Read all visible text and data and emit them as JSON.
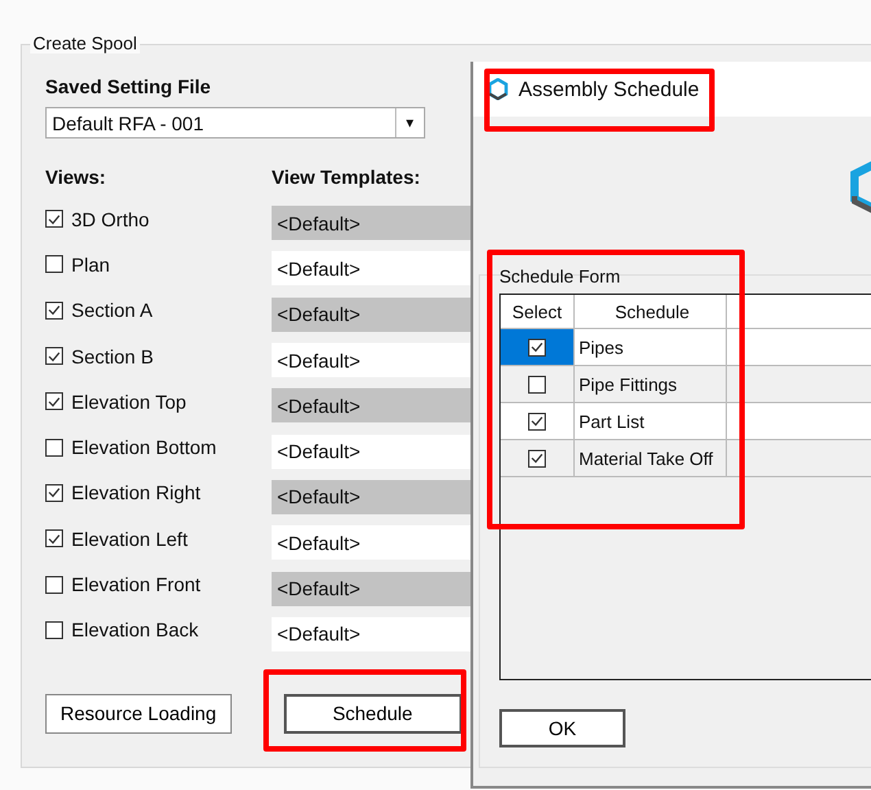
{
  "group_title": "Create Spool",
  "saved_setting": {
    "label": "Saved Setting File",
    "value": "Default RFA - 001",
    "arrow": "▾"
  },
  "views_header": "Views:",
  "templates_header": "View Templates:",
  "views": [
    {
      "name": "3D Ortho",
      "checked": true,
      "template": "<Default>"
    },
    {
      "name": "Plan",
      "checked": false,
      "template": "<Default>"
    },
    {
      "name": "Section A",
      "checked": true,
      "template": "<Default>"
    },
    {
      "name": "Section B",
      "checked": true,
      "template": "<Default>"
    },
    {
      "name": "Elevation Top",
      "checked": true,
      "template": "<Default>"
    },
    {
      "name": "Elevation Bottom",
      "checked": false,
      "template": "<Default>"
    },
    {
      "name": "Elevation Right",
      "checked": true,
      "template": "<Default>"
    },
    {
      "name": "Elevation Left",
      "checked": true,
      "template": "<Default>"
    },
    {
      "name": "Elevation Front",
      "checked": false,
      "template": "<Default>"
    },
    {
      "name": "Elevation Back",
      "checked": false,
      "template": "<Default>"
    }
  ],
  "buttons": [
    {
      "label": "Resource Loading",
      "highlighted": false
    },
    {
      "label": "Schedule",
      "highlighted": true
    }
  ],
  "dialog": {
    "title": "Assembly Schedule",
    "title_highlighted": true,
    "group_title": "Schedule Form",
    "group_highlighted": true,
    "columns": [
      "Select",
      "Schedule"
    ],
    "rows": [
      {
        "checked": true,
        "schedule": "Pipes",
        "selected": true
      },
      {
        "checked": false,
        "schedule": "Pipe Fittings",
        "selected": false
      },
      {
        "checked": true,
        "schedule": "Part List",
        "selected": false
      },
      {
        "checked": true,
        "schedule": "Material Take Off",
        "selected": false
      }
    ],
    "ok": "OK"
  }
}
